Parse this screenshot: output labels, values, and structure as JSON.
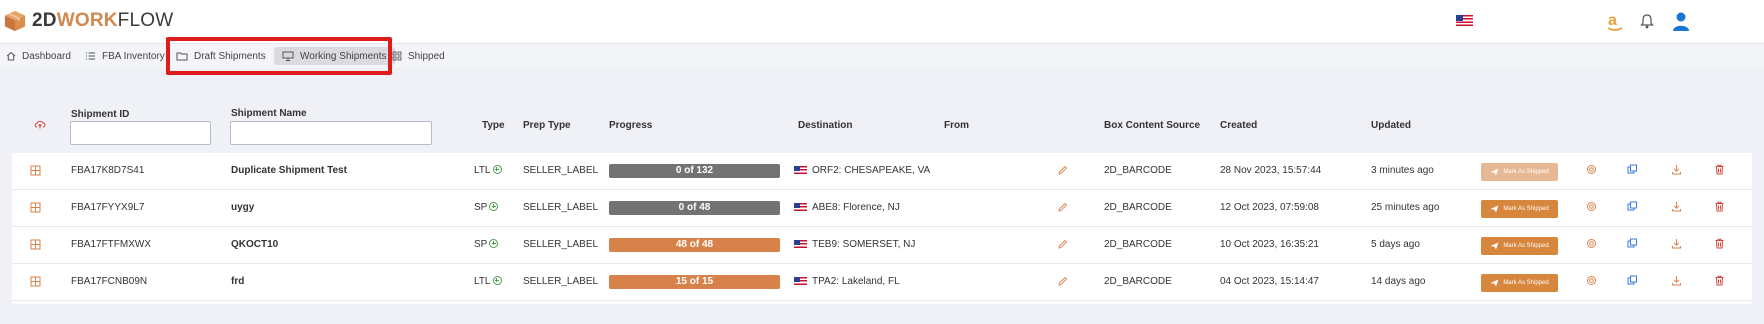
{
  "header": {
    "brand_part1": "2D",
    "brand_part2": "WORK",
    "brand_part3": "FLOW",
    "icons": [
      "box-logo-icon",
      "us-flag-icon",
      "amazon-icon",
      "bell-icon",
      "user-icon"
    ],
    "colors": {
      "brand_orange": "#d2884e",
      "user_blue": "#1976d2"
    }
  },
  "tabs": [
    {
      "label": "Dashboard",
      "icon": "home-icon"
    },
    {
      "label": "FBA Inventory",
      "icon": "list-icon"
    },
    {
      "label": "Draft Shipments",
      "icon": "folder-icon"
    },
    {
      "label": "Working Shipments",
      "icon": "monitor-icon",
      "active": true
    },
    {
      "label": "Shipped",
      "icon": "grid-icon"
    }
  ],
  "table": {
    "columns": {
      "shipment_id": "Shipment ID",
      "shipment_name": "Shipment Name",
      "type": "Type",
      "prep_type": "Prep Type",
      "progress": "Progress",
      "destination": "Destination",
      "from": "From",
      "box_content_source": "Box Content Source",
      "created": "Created",
      "updated": "Updated"
    },
    "filters": {
      "shipment_id": "",
      "shipment_name": ""
    },
    "mark_as_shipped_label": "Mark As Shipped",
    "rows": [
      {
        "id": "FBA17K8D7S41",
        "name": "Duplicate Shipment Test",
        "type": "LTL",
        "prep": "SELLER_LABEL",
        "progress_text": "0 of 132",
        "progress_fraction": 0,
        "progress_color": "gray",
        "destination": "ORF2: CHESAPEAKE, VA",
        "source": "2D_BARCODE",
        "created": "28 Nov 2023, 15:57:44",
        "updated": "3 minutes ago",
        "ship_enabled": false
      },
      {
        "id": "FBA17FYYX9L7",
        "name": "uygy",
        "type": "SP",
        "prep": "SELLER_LABEL",
        "progress_text": "0 of 48",
        "progress_fraction": 0,
        "progress_color": "gray",
        "destination": "ABE8: Florence, NJ",
        "source": "2D_BARCODE",
        "created": "12 Oct 2023, 07:59:08",
        "updated": "25 minutes ago",
        "ship_enabled": true
      },
      {
        "id": "FBA17FTFMXWX",
        "name": "QKOCT10",
        "type": "SP",
        "prep": "SELLER_LABEL",
        "progress_text": "48 of 48",
        "progress_fraction": 1,
        "progress_color": "orange",
        "destination": "TEB9: SOMERSET, NJ",
        "source": "2D_BARCODE",
        "created": "10 Oct 2023, 16:35:21",
        "updated": "5 days ago",
        "ship_enabled": true
      },
      {
        "id": "FBA17FCNB09N",
        "name": "frd",
        "type": "LTL",
        "prep": "SELLER_LABEL",
        "progress_text": "15 of 15",
        "progress_fraction": 1,
        "progress_color": "orange",
        "destination": "TPA2: Lakeland, FL",
        "source": "2D_BARCODE",
        "created": "04 Oct 2023, 15:14:47",
        "updated": "14 days ago",
        "ship_enabled": true
      }
    ]
  }
}
